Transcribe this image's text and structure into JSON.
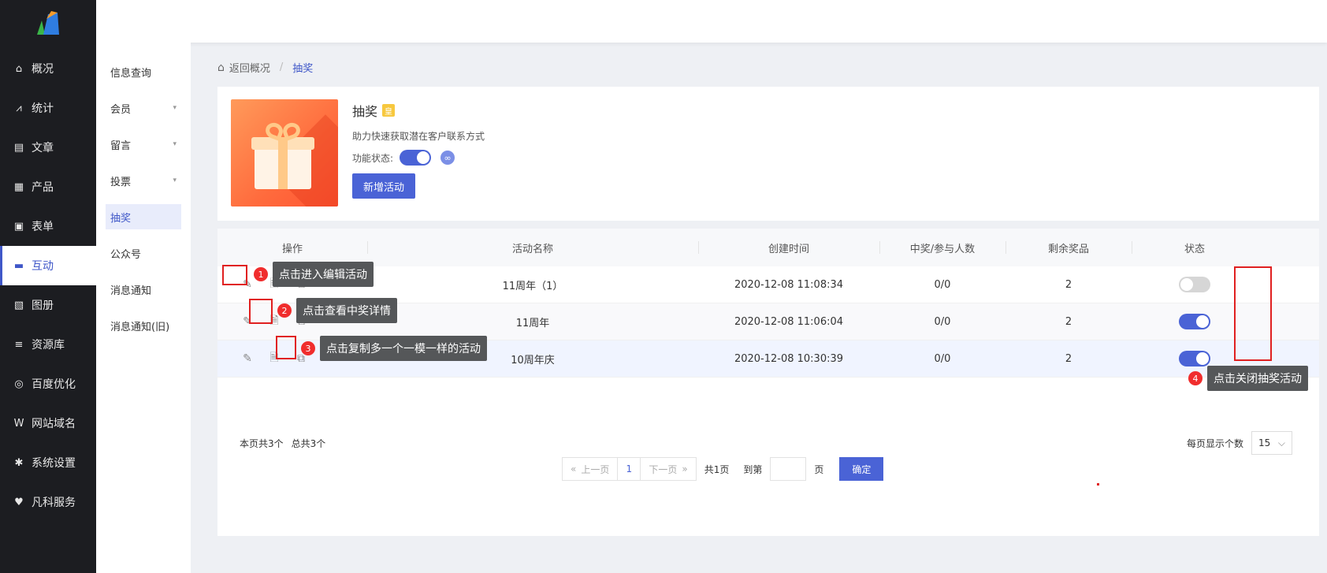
{
  "sidebar": {
    "items": [
      {
        "label": "概况",
        "icon": "home-icon",
        "glyph": "⌂"
      },
      {
        "label": "统计",
        "icon": "chart-icon",
        "glyph": "⩘"
      },
      {
        "label": "文章",
        "icon": "article-icon",
        "glyph": "▤"
      },
      {
        "label": "产品",
        "icon": "product-icon",
        "glyph": "▦"
      },
      {
        "label": "表单",
        "icon": "form-icon",
        "glyph": "▣"
      },
      {
        "label": "互动",
        "icon": "chat-icon",
        "glyph": "▬"
      },
      {
        "label": "图册",
        "icon": "album-icon",
        "glyph": "▧"
      },
      {
        "label": "资源库",
        "icon": "database-icon",
        "glyph": "≡"
      },
      {
        "label": "百度优化",
        "icon": "seo-icon",
        "glyph": "◎"
      },
      {
        "label": "网站域名",
        "icon": "domain-icon",
        "glyph": "W"
      },
      {
        "label": "系统设置",
        "icon": "gear-icon",
        "glyph": "✱"
      },
      {
        "label": "凡科服务",
        "icon": "heart-icon",
        "glyph": "♥"
      }
    ]
  },
  "submenu": {
    "items": [
      {
        "label": "信息查询",
        "caret": ""
      },
      {
        "label": "会员",
        "caret": "▾"
      },
      {
        "label": "留言",
        "caret": "▾"
      },
      {
        "label": "投票",
        "caret": "▾"
      },
      {
        "label": "抽奖",
        "caret": ""
      },
      {
        "label": "公众号",
        "caret": ""
      },
      {
        "label": "消息通知",
        "caret": ""
      },
      {
        "label": "消息通知(旧)",
        "caret": ""
      }
    ]
  },
  "breadcrumb": {
    "back": "返回概况",
    "sep": "/",
    "current": "抽奖"
  },
  "feature": {
    "title": "抽奖",
    "crown": "皇",
    "desc": "助力快速获取潜在客户联系方式",
    "status_label": "功能状态:",
    "link_glyph": "∞",
    "add_button": "新增活动"
  },
  "table": {
    "headers": [
      "操作",
      "活动名称",
      "创建时间",
      "中奖/参与人数",
      "剩余奖品",
      "状态"
    ],
    "rows": [
      {
        "name": "11周年（1）",
        "time": "2020-12-08 11:08:34",
        "win": "0/0",
        "left": "2",
        "on": false
      },
      {
        "name": "11周年",
        "time": "2020-12-08 11:06:04",
        "win": "0/0",
        "left": "2",
        "on": true
      },
      {
        "name": "10周年庆",
        "time": "2020-12-08 10:30:39",
        "win": "0/0",
        "left": "2",
        "on": true
      }
    ],
    "op_glyphs": {
      "edit": "✎",
      "detail": "🗎",
      "copy": "⧉"
    }
  },
  "tips": [
    {
      "num": "1",
      "text": "点击进入编辑活动"
    },
    {
      "num": "2",
      "text": "点击查看中奖详情"
    },
    {
      "num": "3",
      "text": "点击复制多一个一模一样的活动"
    },
    {
      "num": "4",
      "text": "点击关闭抽奖活动"
    }
  ],
  "footer": {
    "page_count": "本页共3个",
    "total_count": "总共3个",
    "per_page_label": "每页显示个数",
    "per_page_value": "15",
    "prev": "上一页",
    "next": "下一页",
    "current_page": "1",
    "total_pages": "共1页",
    "goto": "到第",
    "page_unit": "页",
    "confirm": "确定"
  }
}
